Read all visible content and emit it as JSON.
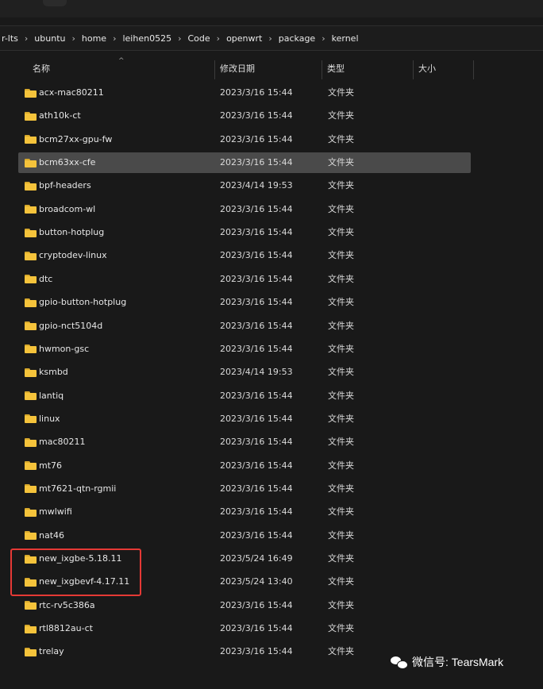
{
  "breadcrumb": [
    {
      "label": "r-lts"
    },
    {
      "label": "ubuntu"
    },
    {
      "label": "home"
    },
    {
      "label": "leihen0525"
    },
    {
      "label": "Code"
    },
    {
      "label": "openwrt"
    },
    {
      "label": "package"
    },
    {
      "label": "kernel"
    }
  ],
  "breadcrumb_separator": "›",
  "columns": {
    "name": "名称",
    "date": "修改日期",
    "type": "类型",
    "size": "大小",
    "sort_indicator": "^"
  },
  "files": [
    {
      "name": "acx-mac80211",
      "date": "2023/3/16 15:44",
      "type": "文件夹",
      "selected": false,
      "icon": "folder-icon"
    },
    {
      "name": "ath10k-ct",
      "date": "2023/3/16 15:44",
      "type": "文件夹",
      "selected": false,
      "icon": "folder-icon"
    },
    {
      "name": "bcm27xx-gpu-fw",
      "date": "2023/3/16 15:44",
      "type": "文件夹",
      "selected": false,
      "icon": "folder-icon"
    },
    {
      "name": "bcm63xx-cfe",
      "date": "2023/3/16 15:44",
      "type": "文件夹",
      "selected": true,
      "icon": "folder-icon"
    },
    {
      "name": "bpf-headers",
      "date": "2023/4/14 19:53",
      "type": "文件夹",
      "selected": false,
      "icon": "folder-icon"
    },
    {
      "name": "broadcom-wl",
      "date": "2023/3/16 15:44",
      "type": "文件夹",
      "selected": false,
      "icon": "folder-icon"
    },
    {
      "name": "button-hotplug",
      "date": "2023/3/16 15:44",
      "type": "文件夹",
      "selected": false,
      "icon": "folder-icon"
    },
    {
      "name": "cryptodev-linux",
      "date": "2023/3/16 15:44",
      "type": "文件夹",
      "selected": false,
      "icon": "folder-icon"
    },
    {
      "name": "dtc",
      "date": "2023/3/16 15:44",
      "type": "文件夹",
      "selected": false,
      "icon": "folder-icon"
    },
    {
      "name": "gpio-button-hotplug",
      "date": "2023/3/16 15:44",
      "type": "文件夹",
      "selected": false,
      "icon": "folder-icon"
    },
    {
      "name": "gpio-nct5104d",
      "date": "2023/3/16 15:44",
      "type": "文件夹",
      "selected": false,
      "icon": "folder-icon"
    },
    {
      "name": "hwmon-gsc",
      "date": "2023/3/16 15:44",
      "type": "文件夹",
      "selected": false,
      "icon": "folder-icon"
    },
    {
      "name": "ksmbd",
      "date": "2023/4/14 19:53",
      "type": "文件夹",
      "selected": false,
      "icon": "folder-icon"
    },
    {
      "name": "lantiq",
      "date": "2023/3/16 15:44",
      "type": "文件夹",
      "selected": false,
      "icon": "folder-icon"
    },
    {
      "name": "linux",
      "date": "2023/3/16 15:44",
      "type": "文件夹",
      "selected": false,
      "icon": "folder-icon"
    },
    {
      "name": "mac80211",
      "date": "2023/3/16 15:44",
      "type": "文件夹",
      "selected": false,
      "icon": "folder-icon"
    },
    {
      "name": "mt76",
      "date": "2023/3/16 15:44",
      "type": "文件夹",
      "selected": false,
      "icon": "folder-icon"
    },
    {
      "name": "mt7621-qtn-rgmii",
      "date": "2023/3/16 15:44",
      "type": "文件夹",
      "selected": false,
      "icon": "folder-icon"
    },
    {
      "name": "mwlwifi",
      "date": "2023/3/16 15:44",
      "type": "文件夹",
      "selected": false,
      "icon": "folder-icon"
    },
    {
      "name": "nat46",
      "date": "2023/3/16 15:44",
      "type": "文件夹",
      "selected": false,
      "icon": "folder-icon"
    },
    {
      "name": "new_ixgbe-5.18.11",
      "date": "2023/5/24 16:49",
      "type": "文件夹",
      "selected": false,
      "icon": "folder-icon"
    },
    {
      "name": "new_ixgbevf-4.17.11",
      "date": "2023/5/24 13:40",
      "type": "文件夹",
      "selected": false,
      "icon": "folder-icon"
    },
    {
      "name": "rtc-rv5c386a",
      "date": "2023/3/16 15:44",
      "type": "文件夹",
      "selected": false,
      "icon": "folder-icon"
    },
    {
      "name": "rtl8812au-ct",
      "date": "2023/3/16 15:44",
      "type": "文件夹",
      "selected": false,
      "icon": "folder-icon"
    },
    {
      "name": "trelay",
      "date": "2023/3/16 15:44",
      "type": "文件夹",
      "selected": false,
      "icon": "folder-icon"
    }
  ],
  "watermark": {
    "text": "微信号: TearsMark",
    "icon": "wechat-icon"
  },
  "colors": {
    "background": "#191919",
    "selection": "#4a4a4a",
    "folder": "#f5c33b",
    "highlight": "#e53935"
  }
}
